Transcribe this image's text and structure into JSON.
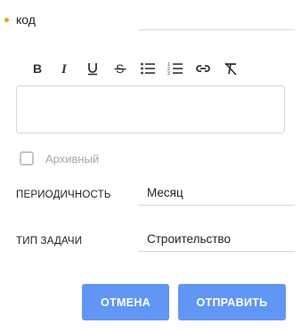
{
  "code_field": {
    "label": "КОД",
    "value": "",
    "required": true
  },
  "toolbar": {
    "items": [
      {
        "icon": "bold-icon",
        "glyph": "B"
      },
      {
        "icon": "italic-icon",
        "glyph": "I"
      },
      {
        "icon": "underline-icon",
        "glyph": "U"
      },
      {
        "icon": "strikethrough-icon",
        "glyph": "S"
      },
      {
        "icon": "bullet-list-icon"
      },
      {
        "icon": "numbered-list-icon"
      },
      {
        "icon": "link-icon"
      },
      {
        "icon": "clear-format-icon"
      }
    ]
  },
  "editor": {
    "value": ""
  },
  "archive": {
    "label": "Архивный",
    "checked": false
  },
  "periodicity": {
    "label": "ПЕРИОДИЧНОСТЬ",
    "value": "Месяц"
  },
  "task_type": {
    "label": "ТИП ЗАДАЧИ",
    "value": "Строительство"
  },
  "actions": {
    "cancel_label": "ОТМЕНА",
    "submit_label": "ОТПРАВИТЬ"
  },
  "colors": {
    "required_dot": "#f0a020",
    "primary_button": "#6196f5"
  }
}
